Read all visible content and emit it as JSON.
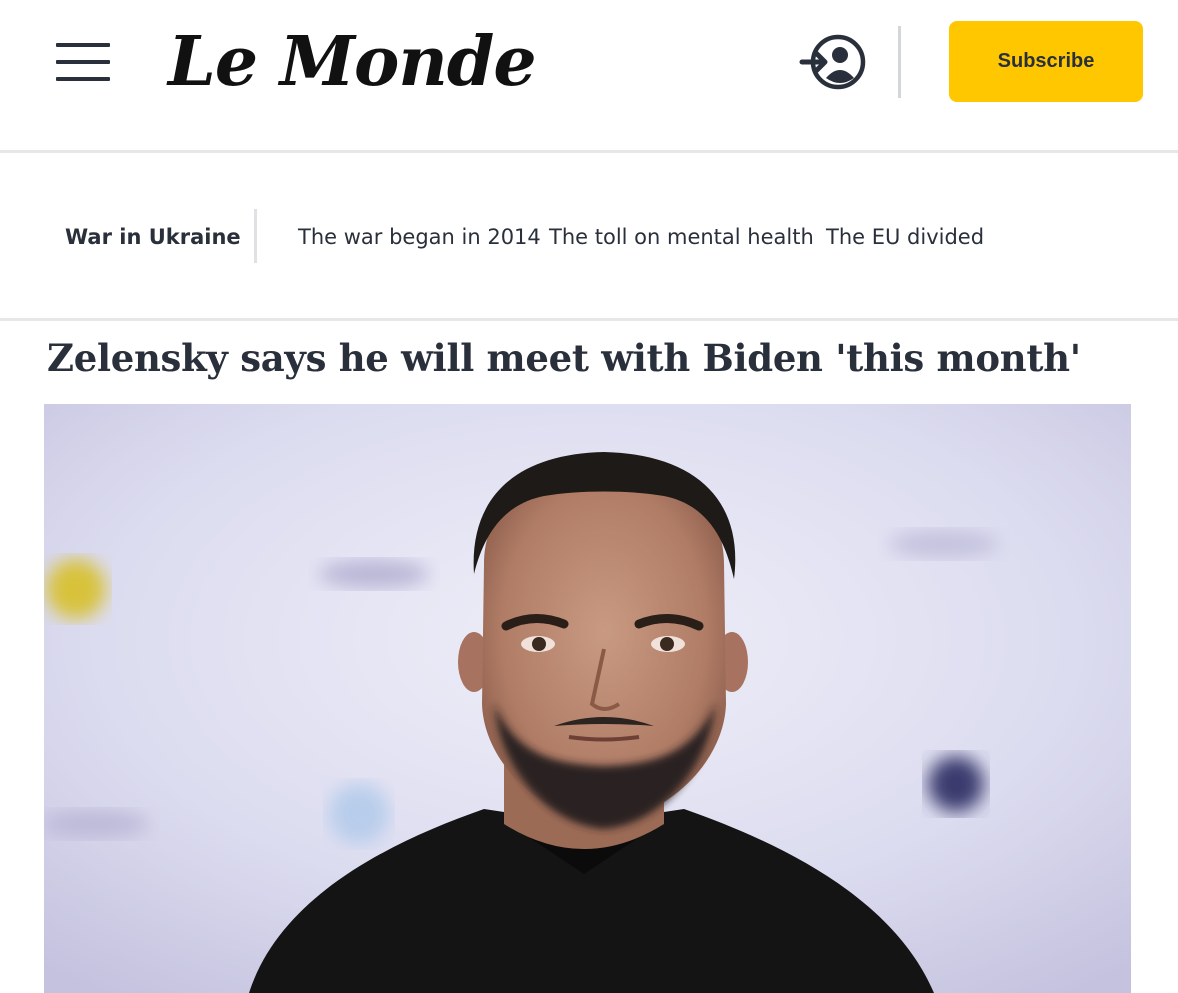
{
  "header": {
    "menu_icon": "hamburger-menu-icon",
    "logo_text": "Le Monde",
    "login_icon": "user-login-icon",
    "subscribe_label": "Subscribe",
    "accent_color": "#ffc700"
  },
  "subnav": {
    "title": "War in Ukraine",
    "links": [
      {
        "label": "The war began in 2014"
      },
      {
        "label": "The toll on mental health"
      },
      {
        "label": "The EU divided"
      }
    ]
  },
  "article": {
    "headline": "Zelensky says he will meet with Biden 'this month'"
  }
}
